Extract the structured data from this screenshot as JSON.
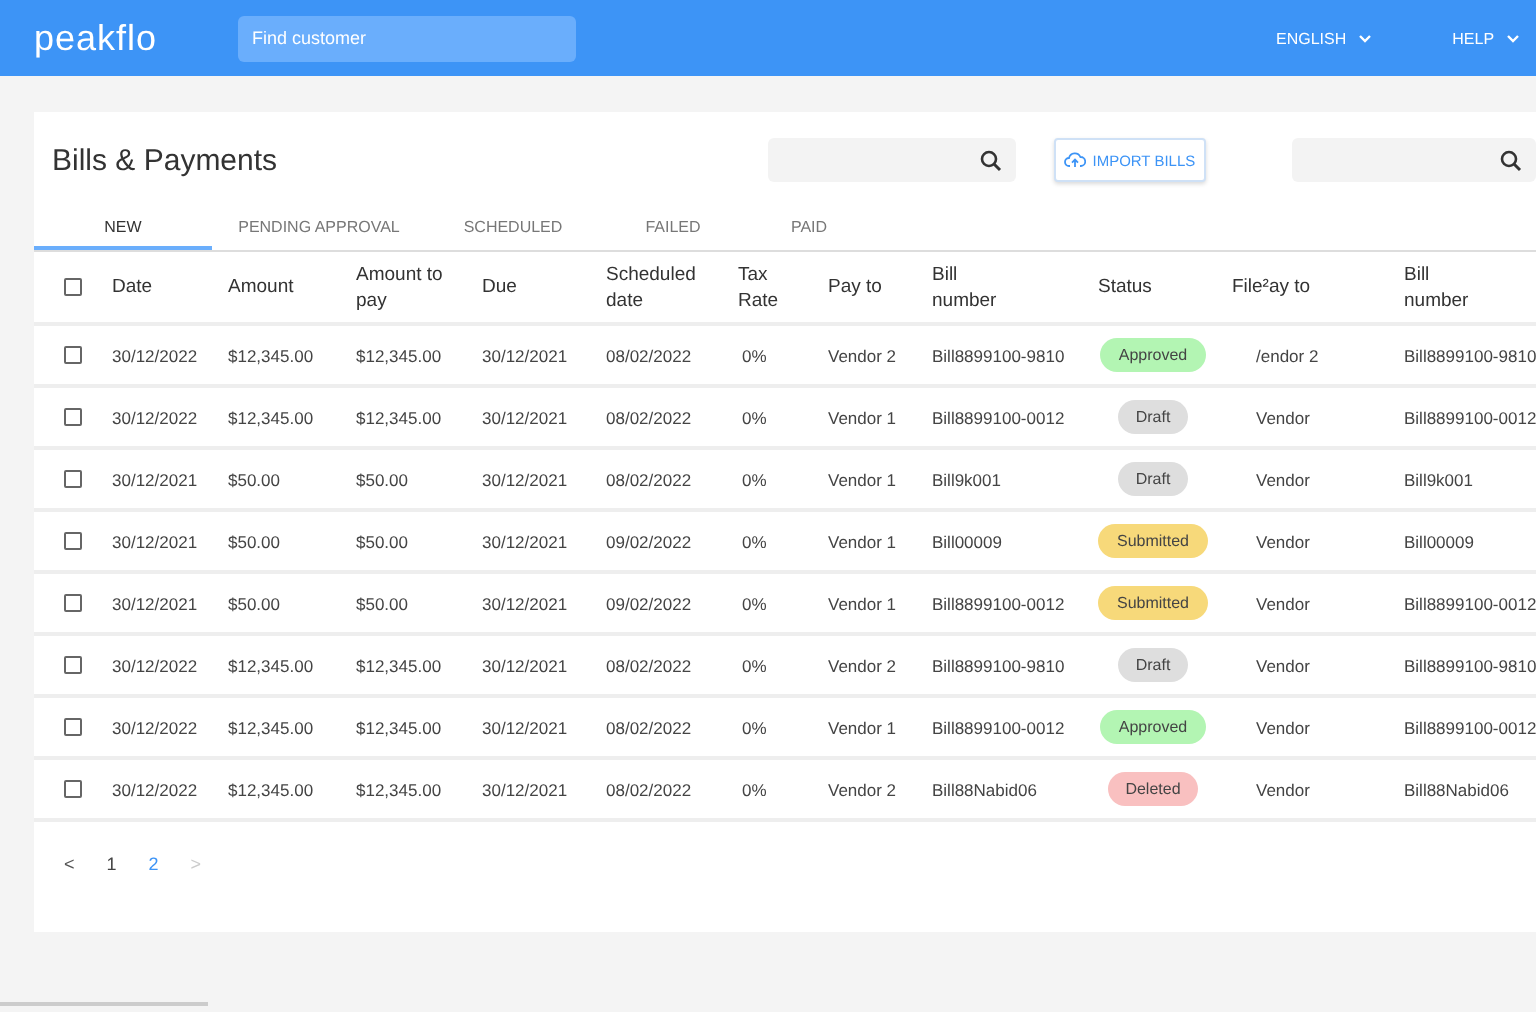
{
  "header": {
    "logo": "peakflo",
    "search": {
      "placeholder": "Find customer"
    },
    "menus": [
      {
        "label": "ENGLISH"
      },
      {
        "label": "HELP"
      }
    ]
  },
  "page": {
    "title": "Bills & Payments",
    "import_button": "IMPORT BILLS"
  },
  "tabs": [
    {
      "label": "NEW",
      "selected": true
    },
    {
      "label": "PENDING APPROVAL",
      "selected": false
    },
    {
      "label": "SCHEDULED",
      "selected": false
    },
    {
      "label": "FAILED",
      "selected": false
    },
    {
      "label": "PAID",
      "selected": false
    }
  ],
  "table": {
    "select_all": {
      "checked": false
    },
    "columns": [
      "Date",
      "Amount",
      "Amount to pay",
      "Due",
      "Scheduled date",
      "Tax Rate",
      "Pay to",
      "Bill number",
      "Status",
      "File²ay to",
      "Bill number"
    ],
    "rows": [
      {
        "checked": false,
        "cells": [
          "30/12/2022",
          "$12,345.00",
          "$12,345.00",
          "30/12/2021",
          "08/02/2022",
          "0%",
          "Vendor 2",
          "Bill8899100-9810"
        ],
        "status": {
          "label": "Approved",
          "color": "#b3f5b3"
        },
        "pay_to_2": "/endor 2",
        "bill_2": "Bill8899100-9810"
      },
      {
        "checked": false,
        "cells": [
          "30/12/2022",
          "$12,345.00",
          "$12,345.00",
          "30/12/2021",
          "08/02/2022",
          "0%",
          "Vendor 1",
          "Bill8899100-0012"
        ],
        "status": {
          "label": "Draft",
          "color": "#dedede"
        },
        "pay_to_2": "Vendor",
        "bill_2": "Bill8899100-0012"
      },
      {
        "checked": false,
        "cells": [
          "30/12/2021",
          "$50.00",
          "$50.00",
          "30/12/2021",
          "08/02/2022",
          "0%",
          "Vendor 1",
          "Bill9k001"
        ],
        "status": {
          "label": "Draft",
          "color": "#dedede"
        },
        "pay_to_2": "Vendor",
        "bill_2": "Bill9k001"
      },
      {
        "checked": false,
        "cells": [
          "30/12/2021",
          "$50.00",
          "$50.00",
          "30/12/2021",
          "09/02/2022",
          "0%",
          "Vendor 1",
          "Bill00009"
        ],
        "status": {
          "label": "Submitted",
          "color": "#f7d97a"
        },
        "pay_to_2": "Vendor",
        "bill_2": "Bill00009"
      },
      {
        "checked": false,
        "cells": [
          "30/12/2021",
          "$50.00",
          "$50.00",
          "30/12/2021",
          "09/02/2022",
          "0%",
          "Vendor 1",
          "Bill8899100-0012"
        ],
        "status": {
          "label": "Submitted",
          "color": "#f7d97a"
        },
        "pay_to_2": "Vendor",
        "bill_2": "Bill8899100-0012"
      },
      {
        "checked": false,
        "cells": [
          "30/12/2022",
          "$12,345.00",
          "$12,345.00",
          "30/12/2021",
          "08/02/2022",
          "0%",
          "Vendor 2",
          "Bill8899100-9810"
        ],
        "status": {
          "label": "Draft",
          "color": "#dedede"
        },
        "pay_to_2": "Vendor",
        "bill_2": "Bill8899100-9810"
      },
      {
        "checked": false,
        "cells": [
          "30/12/2022",
          "$12,345.00",
          "$12,345.00",
          "30/12/2021",
          "08/02/2022",
          "0%",
          "Vendor 1",
          "Bill8899100-0012"
        ],
        "status": {
          "label": "Approved",
          "color": "#b3f5b3"
        },
        "pay_to_2": "Vendor",
        "bill_2": "Bill8899100-0012"
      },
      {
        "checked": false,
        "cells": [
          "30/12/2022",
          "$12,345.00",
          "$12,345.00",
          "30/12/2021",
          "08/02/2022",
          "0%",
          "Vendor 2",
          "Bill88Nabid06"
        ],
        "status": {
          "label": "Deleted",
          "color": "#f9c0c0"
        },
        "pay_to_2": "Vendor",
        "bill_2": "Bill88Nabid06"
      }
    ]
  },
  "pagination": {
    "prev": {
      "label": "<",
      "disabled": false
    },
    "pages": [
      {
        "label": "1",
        "selected": false
      },
      {
        "label": "2",
        "selected": true
      }
    ],
    "next": {
      "label": ">",
      "disabled": true
    }
  }
}
